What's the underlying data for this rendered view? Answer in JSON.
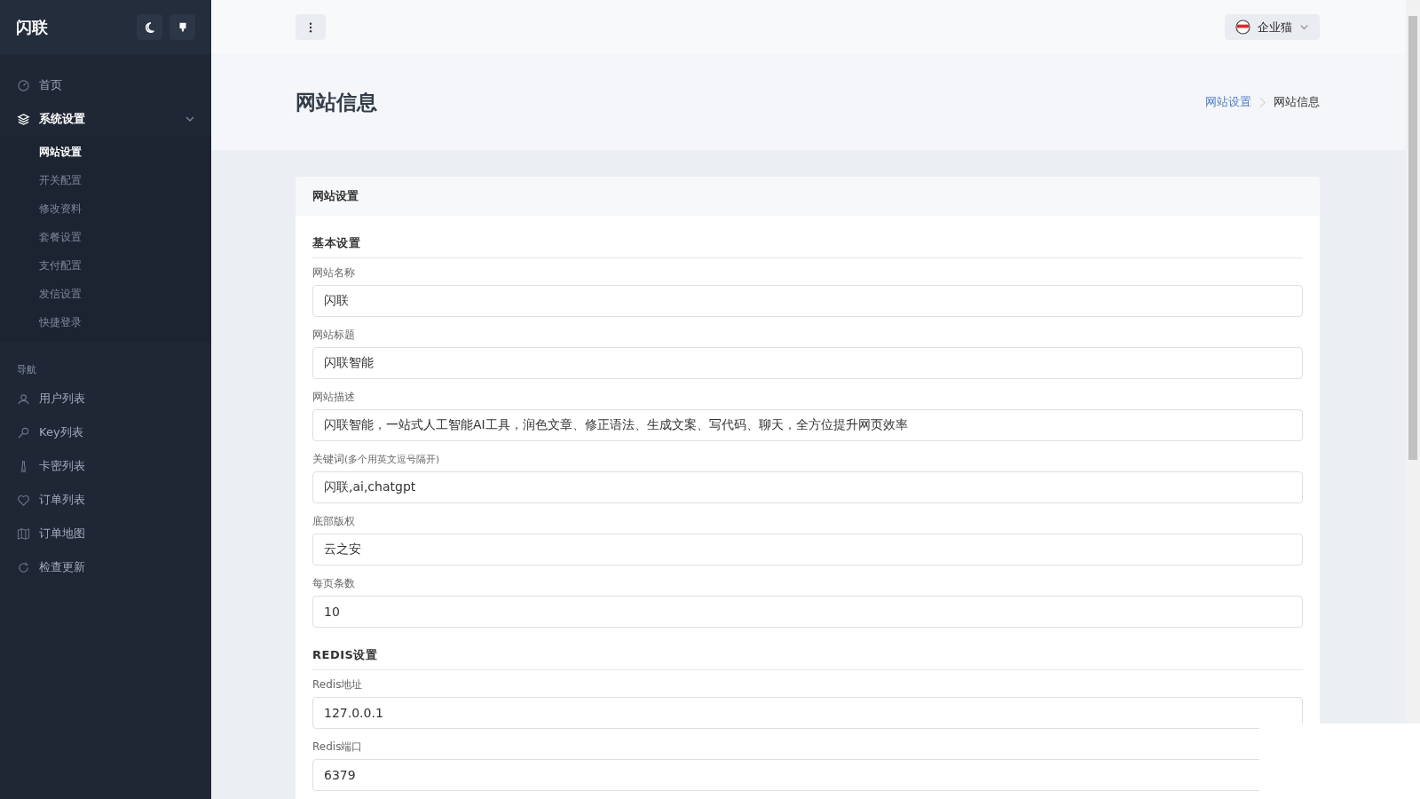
{
  "sidebar": {
    "logo": "闪联",
    "menu": [
      {
        "label": "首页",
        "selected": false
      },
      {
        "label": "系统设置",
        "selected": true,
        "expanded": true,
        "children": [
          {
            "label": "网站设置",
            "selected": true
          },
          {
            "label": "开关配置",
            "selected": false
          },
          {
            "label": "修改资料",
            "selected": false
          },
          {
            "label": "套餐设置",
            "selected": false
          },
          {
            "label": "支付配置",
            "selected": false
          },
          {
            "label": "发信设置",
            "selected": false
          },
          {
            "label": "快捷登录",
            "selected": false
          }
        ]
      }
    ],
    "section": "导航",
    "nav": [
      {
        "label": "用户列表",
        "selected": false
      },
      {
        "label": "Key列表",
        "selected": false
      },
      {
        "label": "卡密列表",
        "selected": false
      },
      {
        "label": "订单列表",
        "selected": false
      },
      {
        "label": "订单地图",
        "selected": false
      },
      {
        "label": "检查更新",
        "selected": false
      }
    ]
  },
  "header": {
    "user": "企业猫"
  },
  "page": {
    "title": "网站信息",
    "breadcrumb": [
      "网站设置",
      "网站信息"
    ]
  },
  "card": {
    "title": "网站设置",
    "sections": [
      {
        "title": "基本设置",
        "fields": [
          {
            "label": "网站名称",
            "value": "闪联"
          },
          {
            "label": "网站标题",
            "value": "闪联智能"
          },
          {
            "label": "网站描述",
            "value": "闪联智能，一站式人工智能AI工具，润色文章、修正语法、生成文案、写代码、聊天，全方位提升网页效率"
          },
          {
            "label": "关键词",
            "hint": "(多个用英文逗号隔开)",
            "value": "闪联,ai,chatgpt"
          },
          {
            "label": "底部版权",
            "value": "云之安"
          },
          {
            "label": "每页条数",
            "value": "10"
          }
        ]
      },
      {
        "title": "REDIS设置",
        "fields": [
          {
            "label": "Redis地址",
            "value": "127.0.0.1"
          },
          {
            "label": "Redis端口",
            "value": "6379"
          }
        ]
      }
    ]
  }
}
